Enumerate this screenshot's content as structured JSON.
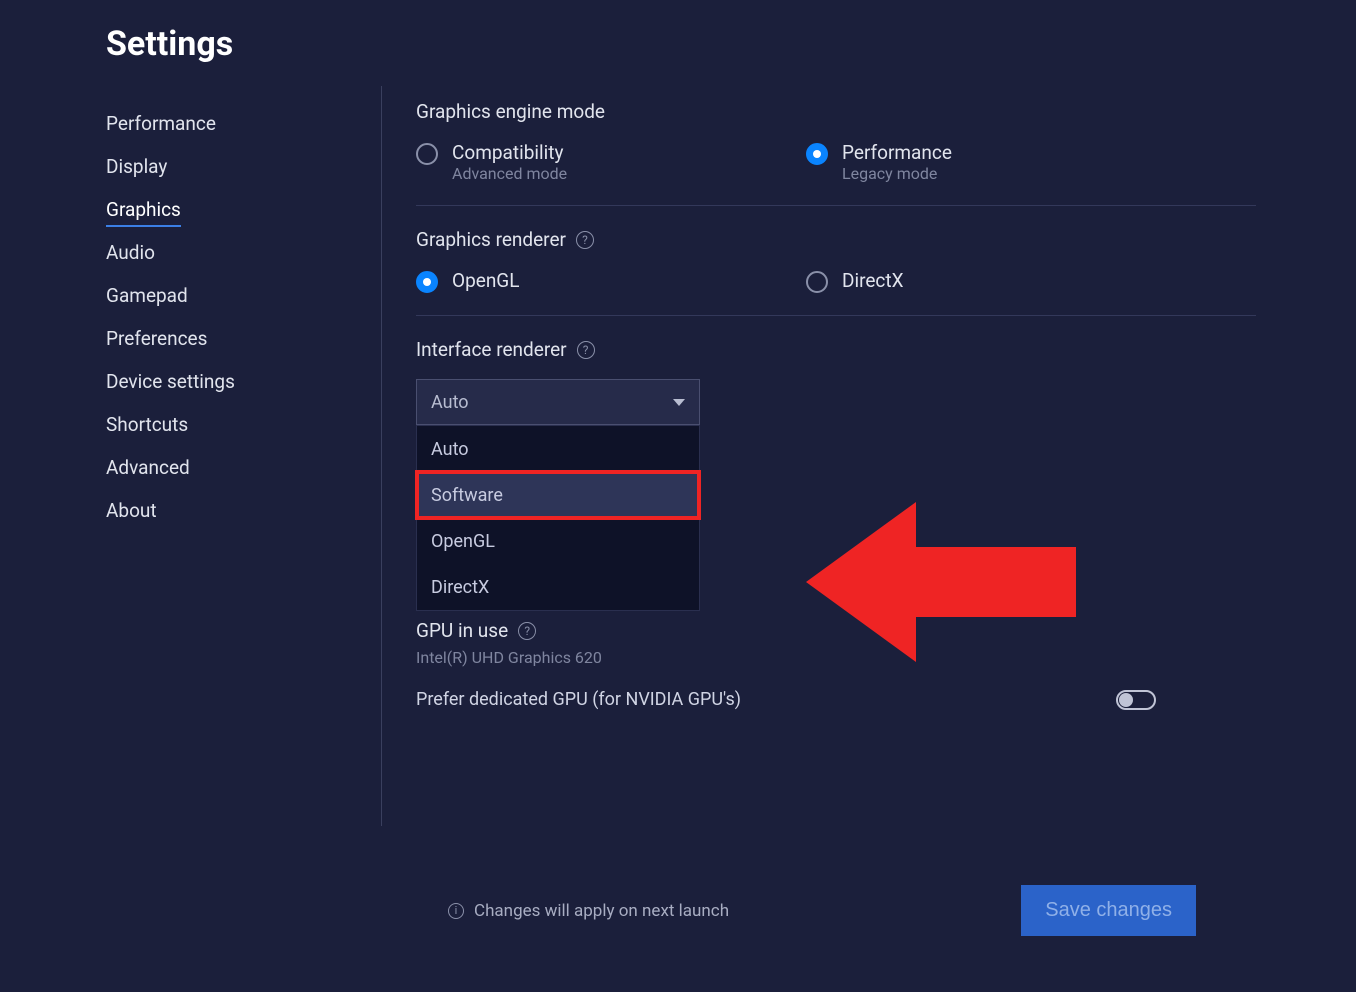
{
  "page_title": "Settings",
  "sidebar": {
    "items": [
      {
        "label": "Performance"
      },
      {
        "label": "Display"
      },
      {
        "label": "Graphics",
        "active": true
      },
      {
        "label": "Audio"
      },
      {
        "label": "Gamepad"
      },
      {
        "label": "Preferences"
      },
      {
        "label": "Device settings"
      },
      {
        "label": "Shortcuts"
      },
      {
        "label": "Advanced"
      },
      {
        "label": "About"
      }
    ]
  },
  "graphics": {
    "engine_mode": {
      "heading": "Graphics engine mode",
      "options": [
        {
          "label": "Compatibility",
          "sub": "Advanced mode",
          "selected": false
        },
        {
          "label": "Performance",
          "sub": "Legacy mode",
          "selected": true
        }
      ]
    },
    "renderer": {
      "heading": "Graphics renderer",
      "options": [
        {
          "label": "OpenGL",
          "selected": true
        },
        {
          "label": "DirectX",
          "selected": false
        }
      ]
    },
    "interface_renderer": {
      "heading": "Interface renderer",
      "selected": "Auto",
      "options": [
        "Auto",
        "Software",
        "OpenGL",
        "DirectX"
      ],
      "highlighted_index": 1
    },
    "gpu": {
      "heading": "GPU in use",
      "value": "Intel(R) UHD Graphics 620",
      "prefer_dedicated_label": "Prefer dedicated GPU (for NVIDIA GPU's)",
      "prefer_dedicated_on": false
    }
  },
  "footer": {
    "note": "Changes will apply on next launch",
    "save_label": "Save changes"
  },
  "annotation": {
    "arrow_color": "#ef2424"
  }
}
